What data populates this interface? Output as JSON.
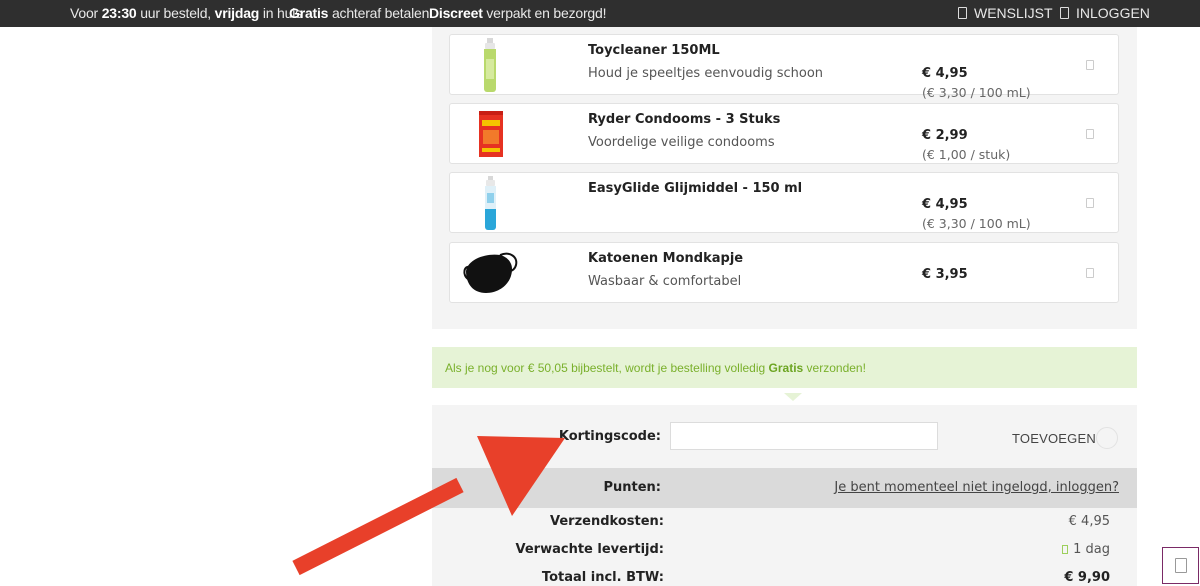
{
  "topbar": {
    "usp1": {
      "pre": "Voor ",
      "time": "23:30",
      "mid": " uur besteld, ",
      "day": "vrijdag",
      "post": " in huis"
    },
    "usp2": {
      "bold": "Gratis",
      "rest": " achteraf betalen"
    },
    "usp3": {
      "bold": "Discreet",
      "rest": " verpakt en bezorgd!"
    },
    "wishlist_label": "WENSLIJST",
    "login_label": "INLOGGEN"
  },
  "products": [
    {
      "name": "Toycleaner 150ML",
      "desc": "Houd je speeltjes eenvoudig schoon",
      "price": "€ 4,95",
      "unit": "(€ 3,30 / 100 mL)",
      "image": "green-spray-bottle"
    },
    {
      "name": "Ryder Condooms - 3 Stuks",
      "desc": "Voordelige veilige condooms",
      "price": "€ 2,99",
      "unit": "(€ 1,00 / stuk)",
      "image": "red-condom-box"
    },
    {
      "name": "EasyGlide Glijmiddel - 150 ml",
      "desc": "",
      "price": "€ 4,95",
      "unit": "(€ 3,30 / 100 mL)",
      "image": "blue-lube-bottle"
    },
    {
      "name": "Katoenen Mondkapje",
      "desc": "Wasbaar & comfortabel",
      "price": "€ 3,95",
      "unit": "",
      "image": "black-face-mask"
    }
  ],
  "notice": {
    "pre": "Als je nog voor € 50,05 bijbestelt, wordt je bestelling volledig ",
    "bold": "Gratis",
    "post": " verzonden!"
  },
  "coupon": {
    "label": "Kortingscode:",
    "value": "",
    "button": "TOEVOEGEN"
  },
  "points": {
    "label": "Punten:",
    "link": "Je bent momenteel niet ingelogd, inloggen?"
  },
  "shipping": {
    "label": "Verzendkosten:",
    "value": "€ 4,95"
  },
  "delivery": {
    "label": "Verwachte levertijd:",
    "value": "1 dag"
  },
  "total": {
    "label": "Totaal incl. BTW:",
    "value": "€ 9,90"
  },
  "colors": {
    "topbar": "#2f2f2f",
    "notice_bg": "#e6f3d6",
    "notice_text": "#7ab02c",
    "annotation_arrow": "#e8402a",
    "corner_button_border": "#7a2a66"
  }
}
